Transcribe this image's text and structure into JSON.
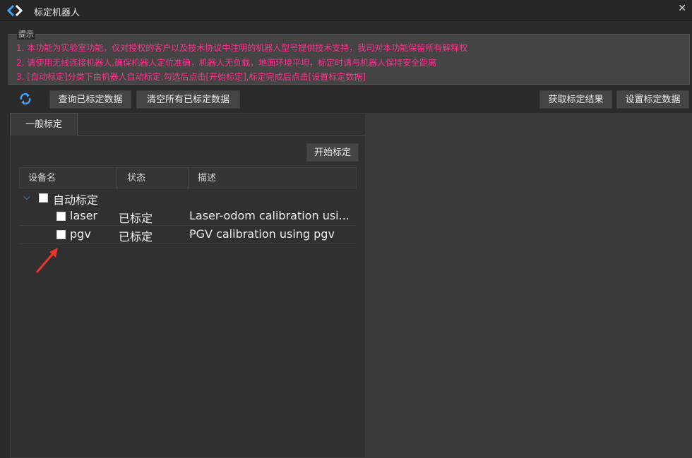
{
  "window": {
    "title": "标定机器人",
    "icon": "diamond-arrows-app-icon",
    "close_icon": "close-icon"
  },
  "notice": {
    "title": "提示",
    "lines": [
      "1. 本功能为实验室功能，仅对授权的客户以及技术协议中注明的机器人型号提供技术支持，我司对本功能保留所有解释权",
      "2. 请使用无线连接机器人,确保机器人定位准确，机器人无负载，地面环境平坦，标定时请与机器人保持安全距离",
      "3. [自动标定]分类下由机器人自动标定,勾选后点击[开始标定],标定完成后点击[设置标定数据]"
    ],
    "text_color": "#ff2f8e"
  },
  "toolbar": {
    "refresh_icon": "refresh-icon",
    "query_label": "查询已标定数据",
    "clear_label": "清空所有已标定数据",
    "fetch_label": "获取标定结果",
    "set_label": "设置标定数据"
  },
  "tabs": [
    {
      "label": "一般标定",
      "selected": true
    }
  ],
  "panel": {
    "start_label": "开始标定",
    "columns": [
      "设备名",
      "状态",
      "描述"
    ],
    "group": {
      "label": "自动标定",
      "expanded": true,
      "checked": false
    },
    "rows": [
      {
        "name": "laser",
        "status": "已标定",
        "desc": "Laser-odom calibration usi...",
        "checked": false
      },
      {
        "name": "pgv",
        "status": "已标定",
        "desc": "PGV calibration using pgv",
        "checked": false
      }
    ]
  },
  "annotation": {
    "icon": "red-arrow-icon",
    "color": "#e8362c"
  },
  "colors": {
    "accent": "#3fa1ff",
    "background": "#2b2b2b"
  }
}
